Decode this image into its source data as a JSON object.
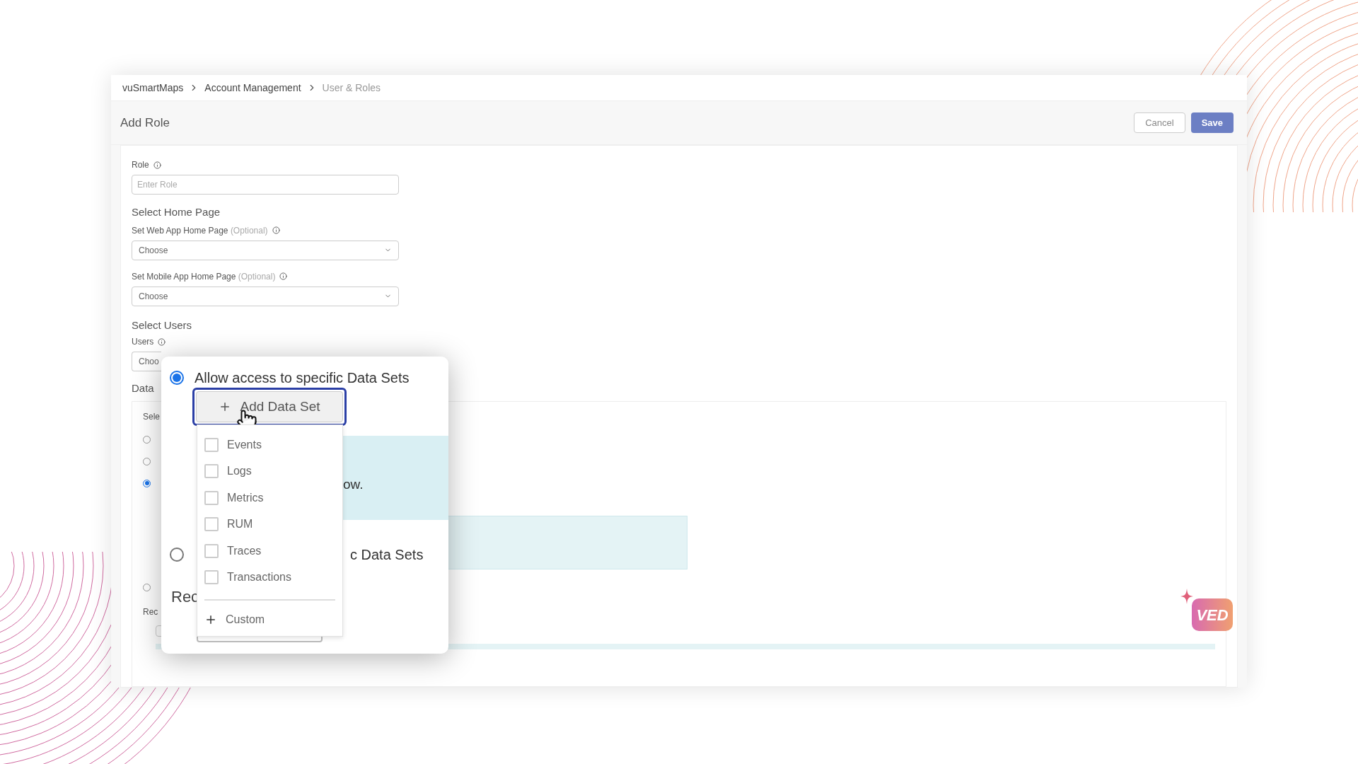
{
  "breadcrumb": [
    {
      "label": "vuSmartMaps",
      "selected": false
    },
    {
      "label": "Account Management",
      "selected": false
    },
    {
      "label": "User & Roles",
      "selected": true
    }
  ],
  "page": {
    "title": "Add Role"
  },
  "actions": [
    {
      "label": "Cancel",
      "kind": "secondary"
    },
    {
      "label": "Save",
      "kind": "primary"
    }
  ],
  "form": {
    "role": {
      "label": "Role",
      "placeholder": "Enter Role"
    },
    "home_page": {
      "heading": "Select Home Page",
      "fields": [
        {
          "label": "Set Web App Home Page",
          "note": "(Optional)",
          "value": "Choose"
        },
        {
          "label": "Set Mobile App Home Page",
          "note": "(Optional)",
          "value": "Choose"
        }
      ]
    },
    "users": {
      "heading": "Select Users",
      "label": "Users",
      "value": "Choo"
    },
    "data": {
      "heading": "Data",
      "label": "Sele",
      "radios": [
        {
          "selected": false
        },
        {
          "selected": false
        },
        {
          "selected": true
        },
        {
          "selected": false
        }
      ],
      "sub_label": "Rec"
    }
  },
  "overlay": {
    "options": [
      {
        "label": "Allow access to specific Data Sets",
        "selected": true
      },
      {
        "label": "c Data Sets",
        "selected": false
      }
    ],
    "add_button": {
      "label": "Add Data Set"
    },
    "panel_text": "ow.",
    "heading": "Rec",
    "menu": {
      "items": [
        {
          "label": "Events",
          "checked": false
        },
        {
          "label": "Logs",
          "checked": false
        },
        {
          "label": "Metrics",
          "checked": false
        },
        {
          "label": "RUM",
          "checked": false
        },
        {
          "label": "Traces",
          "checked": false
        },
        {
          "label": "Transactions",
          "checked": false
        }
      ],
      "custom": "Custom"
    }
  },
  "assistant": {
    "label": "VED"
  }
}
